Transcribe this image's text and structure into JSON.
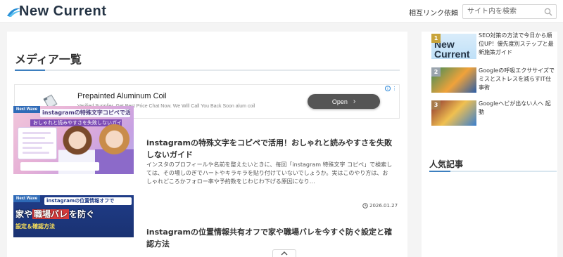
{
  "header": {
    "logo_text": "New Current",
    "link_label": "相互リンク依頼",
    "search_placeholder": "サイト内を検索"
  },
  "main": {
    "title": "メディア一覧"
  },
  "ad": {
    "title": "Prepainted Aluminum Coil",
    "description": "Verified Supplier. Get Best Price Chat Now. We Will Call You Back Soon alum coil",
    "open_label": "Open",
    "badge": "i"
  },
  "articles": [
    {
      "title": "instagramの特殊文字をコピペで活用！おしゃれと読みやすさを失敗しないガイド",
      "excerpt": "インスタのプロフィールや名前を整えたいときに、毎回「instagram 特殊文字 コピペ」で検索しては、その場しのぎでハートやキラキラを貼り付けていないでしょうか。実はこのやり方は、おしゃれどころかフォロー率や予約数をじわじわ下げる原因になり…",
      "date": "2026.01.27",
      "thumb": {
        "tag": "Next Wave",
        "banner": "instagramの特殊文字コピペで活用！",
        "subbanner": "おしゃれと読みやすさを失敗しないガイド"
      }
    },
    {
      "title": "instagramの位置情報共有オフで家や職場バレを今すぐ防ぐ設定と確認方法",
      "thumb": {
        "tag": "Next Wave",
        "line1": "instagramの位置情報オフで",
        "line2_pre": "家や",
        "line2_red": "職場バレ",
        "line2_post": "を防ぐ",
        "line3": "設定＆確認方法"
      }
    }
  ],
  "sidebar": {
    "heading": "人気記事",
    "popular": [
      {
        "rank": "1",
        "title": "SEO対策の方法で今日から順位UP！優先度別ステップと最新施策ガイド",
        "thumb_text": "New Current"
      },
      {
        "rank": "2",
        "title": "Googleの呼吸エクササイズでミスとストレスを減らすIT仕事術"
      },
      {
        "rank": "3",
        "title": "Googleヘビが出ない人へ 起動"
      }
    ]
  },
  "colors": {
    "accent": "#3d7fbf",
    "logo": "#243344",
    "open_button": "#555555"
  }
}
